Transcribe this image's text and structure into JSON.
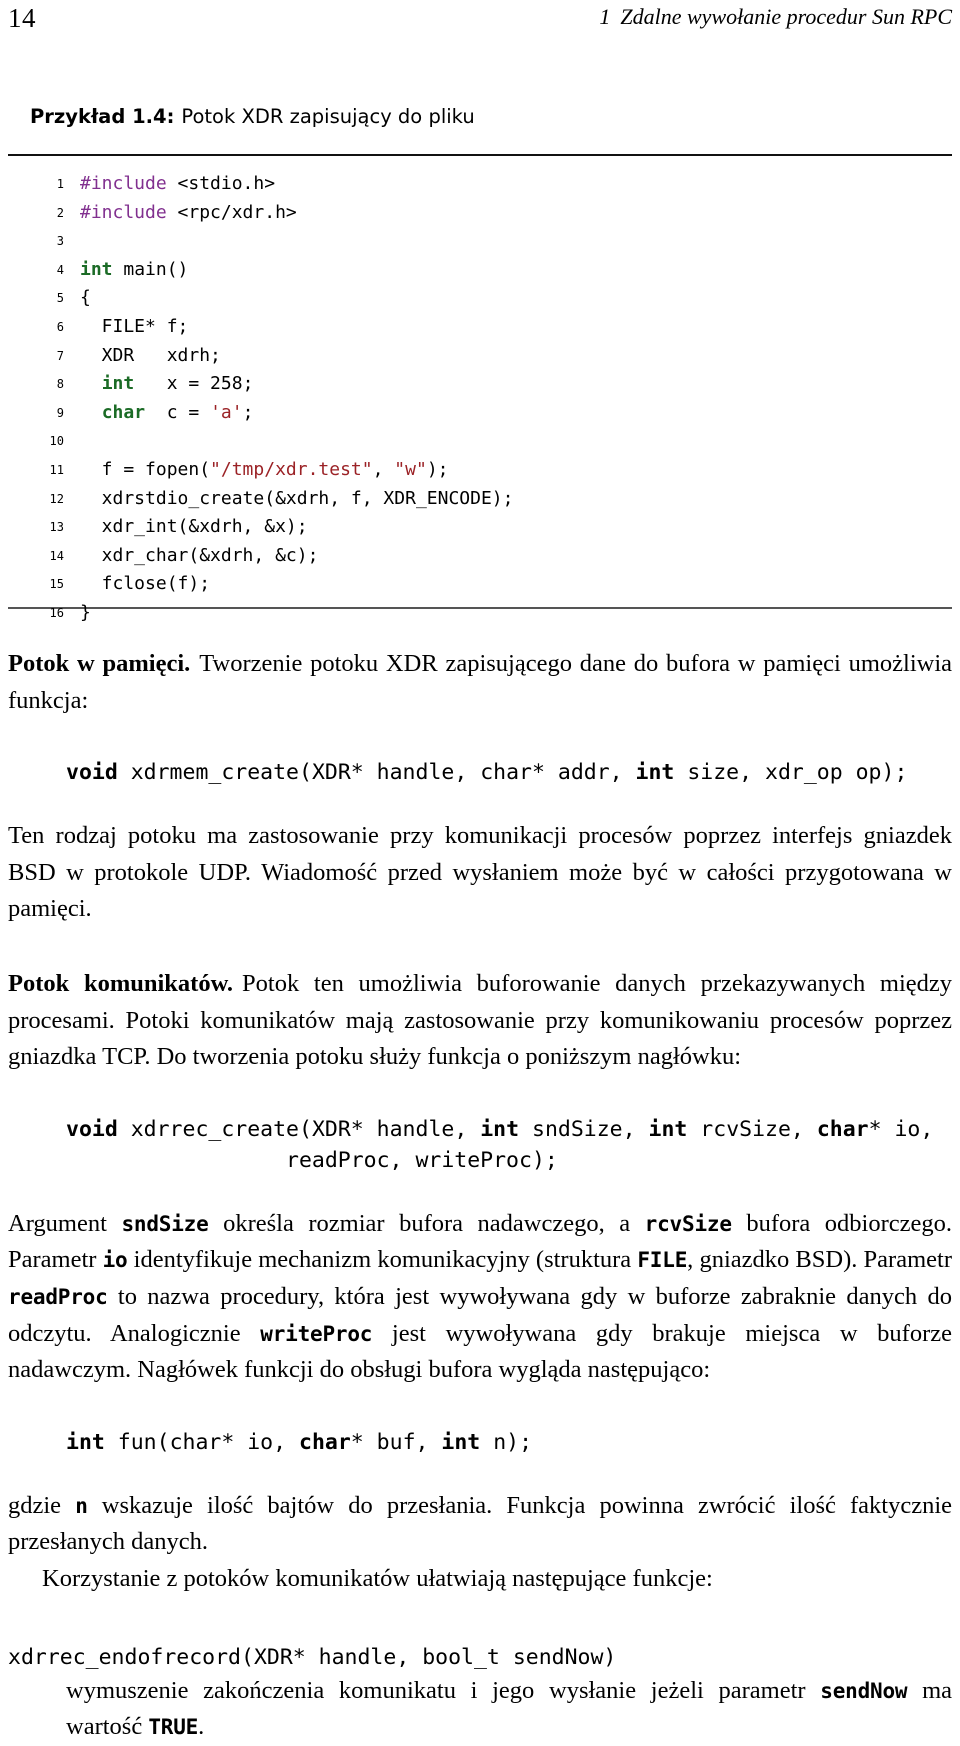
{
  "running_head": {
    "folio": "14",
    "chapter_number": "1",
    "chapter_title": "Zdalne wywołanie procedur Sun RPC"
  },
  "listing": {
    "caption_label": "Przykład 1.4:",
    "caption_text": "Potok XDR zapisujący do pliku",
    "colors": {
      "keyword": "#1b6b26",
      "preprocessor": "#81308f",
      "string": "#9b2226",
      "rule": "#3f3f3f"
    },
    "lines": [
      {
        "no": "1",
        "text": "#include <stdio.h>"
      },
      {
        "no": "2",
        "text": "#include <rpc/xdr.h>"
      },
      {
        "no": "3",
        "text": ""
      },
      {
        "no": "4",
        "text": "int main()"
      },
      {
        "no": "5",
        "text": "{"
      },
      {
        "no": "6",
        "text": "  FILE* f;"
      },
      {
        "no": "7",
        "text": "  XDR   xdrh;"
      },
      {
        "no": "8",
        "text": "  int   x = 258;"
      },
      {
        "no": "9",
        "text": "  char  c = 'a';"
      },
      {
        "no": "10",
        "text": ""
      },
      {
        "no": "11",
        "text": "  f = fopen(\"/tmp/xdr.test\", \"w\");"
      },
      {
        "no": "12",
        "text": "  xdrstdio_create(&xdrh, f, XDR_ENCODE);"
      },
      {
        "no": "13",
        "text": "  xdr_int(&xdrh, &x);"
      },
      {
        "no": "14",
        "text": "  xdr_char(&xdrh, &c);"
      },
      {
        "no": "15",
        "text": "  fclose(f);"
      },
      {
        "no": "16",
        "text": "}"
      }
    ]
  },
  "sections": {
    "memory_stream": {
      "lead": "Potok w pamięci.",
      "intro": "Tworzenie potoku XDR zapisującego dane do bufora w pamięci umożliwia funkcja:",
      "signature": {
        "kw1": "void",
        "rest1": " xdrmem_create(XDR* handle, char* addr, ",
        "kw2": "int",
        "rest2": " size, xdr_op op);"
      },
      "paragraph": "Ten rodzaj potoku ma zastosowanie przy komunikacji procesów poprzez interfejs gniazdek BSD w protokole UDP. Wiadomość przed wysłaniem może być w całości przygotowana w pamięci."
    },
    "record_stream": {
      "lead": "Potok komunikatów.",
      "intro": "Potok ten umożliwia buforowanie danych przekazywanych między procesami. Potoki komunikatów mają zastosowanie przy komunikowaniu procesów poprzez gniazdka TCP. Do tworzenia potoku służy funkcja o poniższym nagłówku:",
      "signature_line1": {
        "kw1": "void",
        "p1": " xdrrec_create(XDR* handle, ",
        "kw2": "int",
        "p2": " sndSize, ",
        "kw3": "int",
        "p3": " rcvSize, ",
        "kw4": "char",
        "p4": "* io,"
      },
      "signature_line2": "readProc, writeProc);",
      "explain_1a": "Argument ",
      "explain_1b": "sndSize",
      "explain_1c": " określa rozmiar bufora nadawczego, a ",
      "explain_1d": "rcvSize",
      "explain_1e": " bufora odbiorczego. Parametr ",
      "explain_1f": "io",
      "explain_1g": " identyfikuje mechanizm komunikacyjny (struktura ",
      "explain_1h": "FILE",
      "explain_1i": ", gniazdko BSD). Parametr ",
      "explain_1j": "readProc",
      "explain_1k": " to nazwa procedury, która jest wywoływana gdy w buforze zabraknie danych do odczytu. Analogicznie ",
      "explain_1l": "writeProc",
      "explain_1m": " jest wywoływana gdy brakuje miejsca w buforze nadawczym. Nagłówek funkcji do obsługi bufora wygląda następująco:",
      "signature_fun": {
        "kw1": "int",
        "p1": " fun(char* io, ",
        "kw2": "char",
        "p2": "* buf, ",
        "kw3": "int",
        "p3": " n);"
      },
      "explain_2a": "gdzie ",
      "explain_2b": "n",
      "explain_2c": " wskazuje ilość bajtów do przesłania. Funkcja powinna zwrócić ilość faktycznie przesłanych danych.",
      "explain_3": "Korzystanie z potoków komunikatów ułatwiają następujące funkcje:",
      "func_entry": {
        "signature": "xdrrec_endofrecord(XDR* handle, bool_t sendNow)",
        "desc_a": "wymuszenie zakończenia komunikatu i jego wysłanie jeżeli parametr ",
        "desc_b": "sendNow",
        "desc_c": " ma wartość ",
        "desc_d": "TRUE",
        "desc_e": "."
      }
    }
  }
}
